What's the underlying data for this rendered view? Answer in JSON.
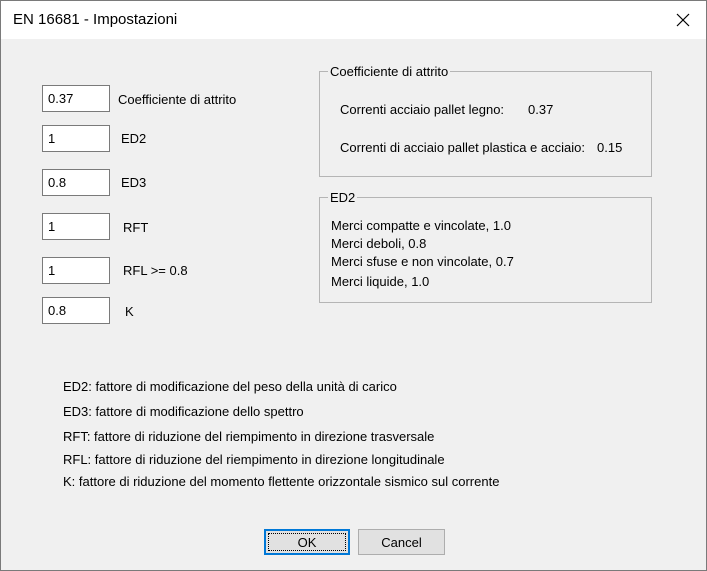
{
  "window": {
    "title": "EN 16681 - Impostazioni"
  },
  "icons": {
    "close": "close-icon"
  },
  "fields": [
    {
      "value": "0.37",
      "label": "Coefficiente di attrito"
    },
    {
      "value": "1",
      "label": "ED2"
    },
    {
      "value": "0.8",
      "label": "ED3"
    },
    {
      "value": "1",
      "label": "RFT"
    },
    {
      "value": "1",
      "label": "RFL >= 0.8"
    },
    {
      "value": "0.8",
      "label": "K"
    }
  ],
  "friction_group": {
    "title": "Coefficiente di attrito",
    "rows": [
      {
        "label": "Correnti acciaio pallet legno:",
        "value": "0.37"
      },
      {
        "label": "Correnti di acciaio pallet plastica e acciaio:",
        "value": "0.15"
      }
    ]
  },
  "ed2_group": {
    "title": "ED2",
    "items": [
      "Merci compatte e vincolate, 1.0",
      "Merci deboli, 0.8",
      "Merci sfuse e non vincolate, 0.7",
      "Merci liquide, 1.0"
    ]
  },
  "notes": [
    "ED2: fattore di modificazione del peso della unità di carico",
    "ED3: fattore di modificazione dello spettro",
    "RFT: fattore di riduzione del riempimento in direzione trasversale",
    "RFL: fattore di riduzione del riempimento in direzione longitudinale",
    "K: fattore di riduzione del momento flettente orizzontale sismico sul corrente"
  ],
  "buttons": {
    "ok": "OK",
    "cancel": "Cancel"
  },
  "colors": {
    "focus_border": "#0078d7",
    "dialog_background": "#f0f0f0"
  }
}
